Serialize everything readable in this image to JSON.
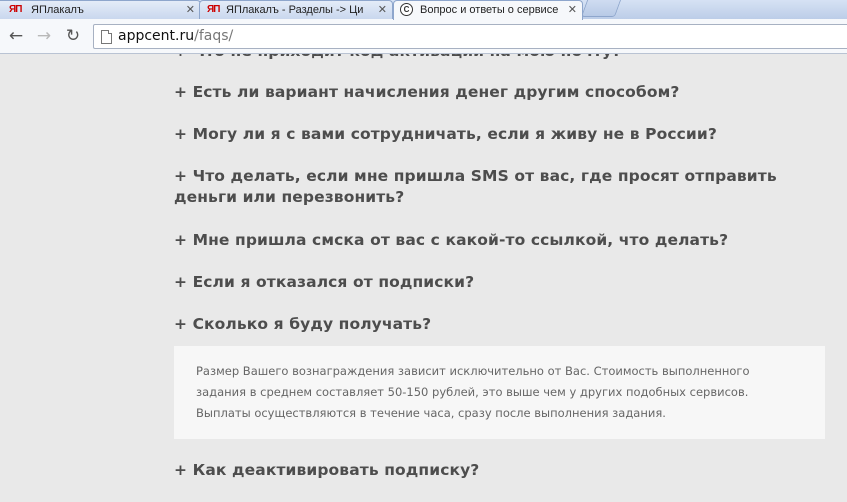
{
  "browser": {
    "tabs": [
      {
        "favicon": "ЯП",
        "title": "ЯПлакалъ"
      },
      {
        "favicon": "ЯП",
        "title": "ЯПлакалъ - Разделы -> Ци"
      },
      {
        "favicon": "C",
        "title": "Вопрос и ответы о сервисе"
      }
    ],
    "url_domain": "appcent.ru",
    "url_path": "/faqs/"
  },
  "faqs": {
    "cut_item": "+ Что не приходит код активации на мою почту?",
    "items": [
      "+ Есть ли вариант начисления денег другим способом?",
      "+ Могу ли я с вами сотрудничать, если я живу не в России?",
      "+ Что делать, если мне пришла SMS от вас, где просят отправить деньги или перезвонить?",
      "+ Мне пришла смска от вас с какой-то ссылкой, что делать?",
      "+ Если я отказался от подписки?",
      "+ Сколько я буду получать?"
    ],
    "answer": "Размер Вашего вознаграждения зависит исключительно от Вас. Стоимость выполненного задания в среднем составляет 50-150 рублей, это выше чем у других подобных сервисов. Выплаты осуществляются в течение часа, сразу после выполнения задания.",
    "last_item": "+ Как деактивировать подписку?"
  }
}
